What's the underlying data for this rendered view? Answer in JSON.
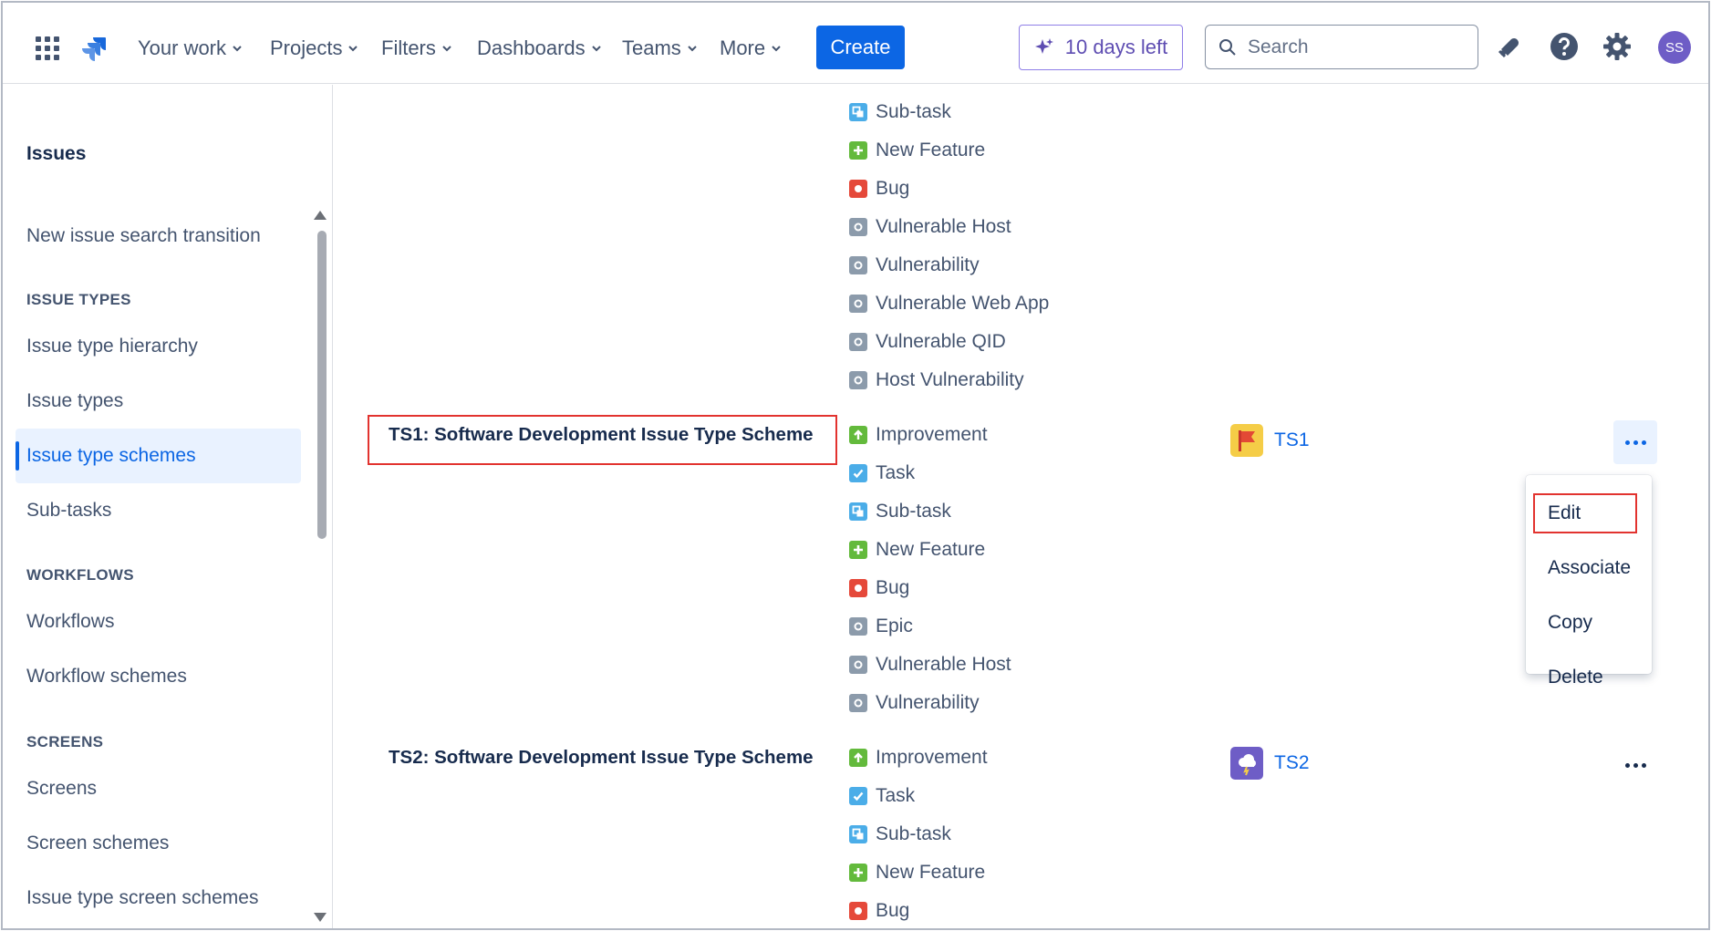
{
  "nav": {
    "items": [
      "Your work",
      "Projects",
      "Filters",
      "Dashboards",
      "Teams",
      "More"
    ],
    "create_label": "Create",
    "trial_label": "10 days left",
    "search_placeholder": "Search",
    "avatar_initials": "SS"
  },
  "sidebar": {
    "title": "Issues",
    "top_item": "New issue search transition",
    "sections": [
      {
        "heading": "ISSUE TYPES",
        "items": [
          "Issue type hierarchy",
          "Issue types",
          "Issue type schemes",
          "Sub-tasks"
        ]
      },
      {
        "heading": "WORKFLOWS",
        "items": [
          "Workflows",
          "Workflow schemes"
        ]
      },
      {
        "heading": "SCREENS",
        "items": [
          "Screens",
          "Screen schemes",
          "Issue type screen schemes"
        ]
      }
    ],
    "active_item": "Issue type schemes"
  },
  "schemes": {
    "previous": {
      "types": [
        "Sub-task",
        "New Feature",
        "Bug",
        "Vulnerable Host",
        "Vulnerability",
        "Vulnerable Web App",
        "Vulnerable QID",
        "Host Vulnerability"
      ]
    },
    "ts1": {
      "name": "TS1: Software Development Issue Type Scheme",
      "types": [
        "Improvement",
        "Task",
        "Sub-task",
        "New Feature",
        "Bug",
        "Epic",
        "Vulnerable Host",
        "Vulnerability"
      ],
      "project": "TS1"
    },
    "ts2": {
      "name": "TS2: Software Development Issue Type Scheme",
      "types": [
        "Improvement",
        "Task",
        "Sub-task",
        "New Feature",
        "Bug"
      ],
      "project": "TS2"
    }
  },
  "menu": {
    "items": [
      "Edit",
      "Associate",
      "Copy",
      "Delete"
    ]
  },
  "colors": {
    "primary": "#0c66e4",
    "highlight_box": "#e2332f",
    "trial_purple": "#5e4db2"
  }
}
